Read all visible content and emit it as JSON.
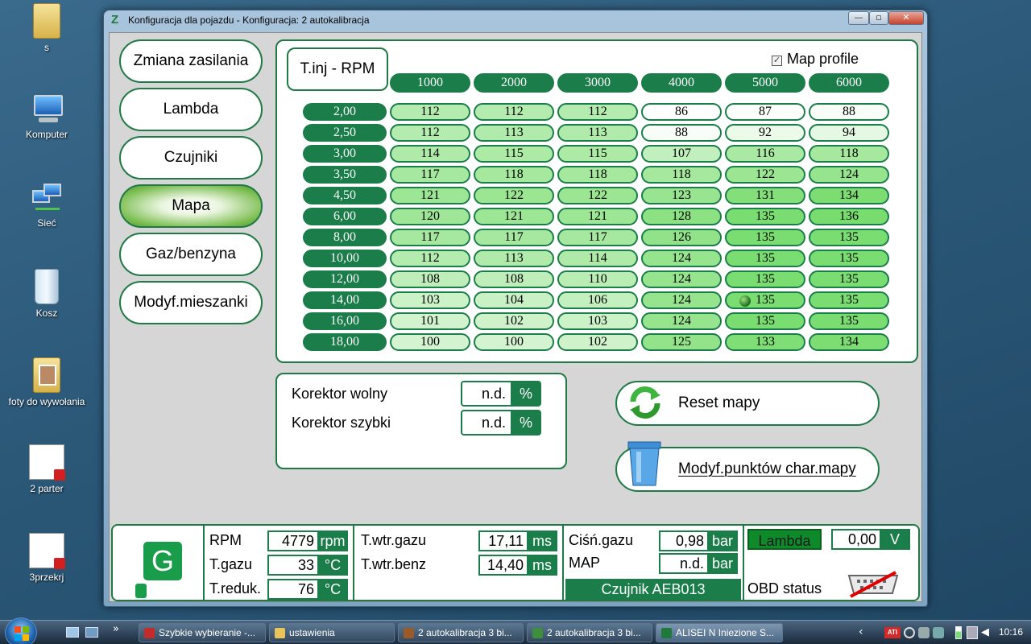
{
  "desktop": {
    "icons": [
      {
        "label": "s",
        "icon": "folder-icon"
      },
      {
        "label": "Komputer",
        "icon": "computer-icon"
      },
      {
        "label": "Sieć",
        "icon": "network-icon"
      },
      {
        "label": "Kosz",
        "icon": "recycle-bin-icon"
      },
      {
        "label": "foty do wywołania",
        "icon": "photo-folder-icon"
      },
      {
        "label": "2 parter",
        "icon": "pdf-file-icon"
      },
      {
        "label": "3przekrj",
        "icon": "pdf-file-icon"
      }
    ]
  },
  "window": {
    "title": "Konfiguracja dla pojazdu - Konfiguracja: 2 autokalibracja",
    "logo": "Z",
    "minimize": "—",
    "maximize": "▫",
    "close": "✕"
  },
  "nav": {
    "items": [
      {
        "label": "Zmiana zasilania",
        "active": false
      },
      {
        "label": "Lambda",
        "active": false
      },
      {
        "label": "Czujniki",
        "active": false
      },
      {
        "label": "Mapa",
        "active": true
      },
      {
        "label": "Gaz/benzyna",
        "active": false
      },
      {
        "label": "Modyf.mieszanki",
        "active": false
      }
    ]
  },
  "map": {
    "corner_label": "T.inj - RPM",
    "map_profile_label": "Map profile",
    "map_profile_checked": true,
    "columns": [
      "1000",
      "2000",
      "3000",
      "4000",
      "5000",
      "6000"
    ],
    "rows": [
      "2,00",
      "2,50",
      "3,00",
      "3,50",
      "4,50",
      "6,00",
      "8,00",
      "10,00",
      "12,00",
      "14,00",
      "16,00",
      "18,00"
    ],
    "values": [
      [
        112,
        112,
        112,
        86,
        87,
        88
      ],
      [
        112,
        113,
        113,
        88,
        92,
        94
      ],
      [
        114,
        115,
        115,
        107,
        116,
        118
      ],
      [
        117,
        118,
        118,
        118,
        122,
        124
      ],
      [
        121,
        122,
        122,
        123,
        131,
        134
      ],
      [
        120,
        121,
        121,
        128,
        135,
        136
      ],
      [
        117,
        117,
        117,
        126,
        135,
        135
      ],
      [
        112,
        113,
        114,
        124,
        135,
        135
      ],
      [
        108,
        108,
        110,
        124,
        135,
        135
      ],
      [
        103,
        104,
        106,
        124,
        135,
        135
      ],
      [
        101,
        102,
        103,
        124,
        135,
        135
      ],
      [
        100,
        100,
        102,
        125,
        133,
        134
      ]
    ],
    "cursor_row": 9,
    "cursor_col": 4
  },
  "korektor": {
    "wolny_label": "Korektor wolny",
    "wolny_value": "n.d.",
    "szybki_label": "Korektor szybki",
    "szybki_value": "n.d.",
    "unit": "%"
  },
  "actions": {
    "reset_label": "Reset mapy",
    "modyf_label": "Modyf.punktów char.mapy"
  },
  "status": {
    "mode_letter": "G",
    "rpm_label": "RPM",
    "rpm_value": "4779",
    "rpm_unit": "rpm",
    "tgazu_label": "T.gazu",
    "tgazu_value": "33",
    "tgazu_unit": "°C",
    "treduk_label": "T.reduk.",
    "treduk_value": "76",
    "treduk_unit": "°C",
    "twtrgazu_label": "T.wtr.gazu",
    "twtrgazu_value": "17,11",
    "twtrgazu_unit": "ms",
    "twtrbenz_label": "T.wtr.benz",
    "twtrbenz_value": "14,40",
    "twtrbenz_unit": "ms",
    "cisn_label": "Ciśń.gazu",
    "cisn_value": "0,98",
    "cisn_unit": "bar",
    "map_label": "MAP",
    "map_value": "n.d.",
    "map_unit": "bar",
    "sensor_label": "Czujnik AEB013",
    "lambda_label": "Lambda",
    "lambda_value": "0,00",
    "lambda_unit": "V",
    "obd_label": "OBD status"
  },
  "taskbar": {
    "tasks": [
      {
        "label": "Szybkie wybieranie -...",
        "active": false,
        "color": "#c42b2b"
      },
      {
        "label": "ustawienia",
        "active": false,
        "color": "#e8c45a"
      },
      {
        "label": "2 autokalibracja 3 bi...",
        "active": false,
        "color": "#9a5a2a"
      },
      {
        "label": "2 autokalibracja 3 bi...",
        "active": false,
        "color": "#3d8f3d"
      },
      {
        "label": "ALISEI N Iniezione S...",
        "active": true,
        "color": "#1e7a3a"
      }
    ],
    "chevron": "»",
    "tray_chevron": "‹",
    "ati": "ATI",
    "clock": "10:16"
  }
}
